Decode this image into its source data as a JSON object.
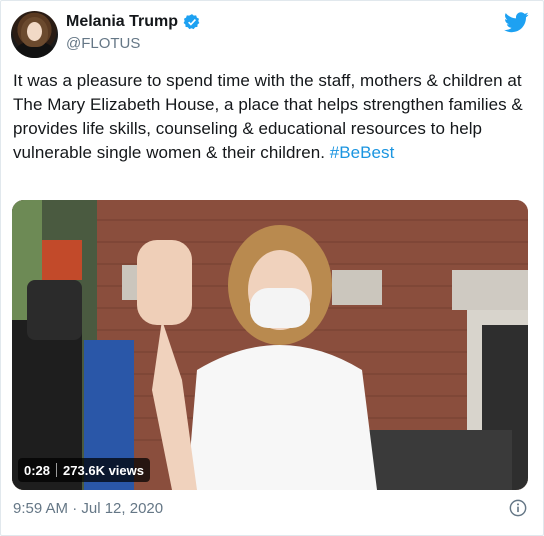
{
  "user": {
    "name": "Melania Trump",
    "handle": "@FLOTUS",
    "verified": true
  },
  "tweet": {
    "text": "It was a pleasure to spend time with the staff, mothers & children at The Mary Elizabeth House, a place that helps strengthen families & provides life skills, counseling & educational resources to help vulnerable single women & their children. ",
    "hashtag": "#BeBest"
  },
  "video": {
    "duration": "0:28",
    "views": "273.6K views"
  },
  "timestamp": "9:59 AM · Jul 12, 2020",
  "icons": {
    "verified": "verified-badge-icon",
    "logo": "twitter-bird-icon",
    "info": "info-icon"
  },
  "colors": {
    "accent": "#1da1f2",
    "hashtag": "#1b95e0",
    "secondary_text": "#657786"
  }
}
